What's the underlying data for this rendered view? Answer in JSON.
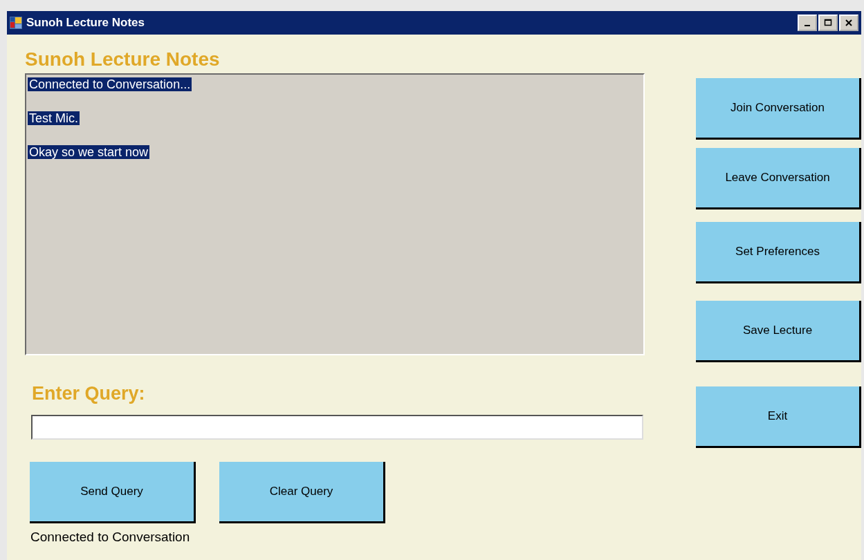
{
  "window": {
    "title": "Sunoh Lecture Notes"
  },
  "heading": "Sunoh Lecture Notes",
  "log": [
    {
      "text": "Connected to Conversation...",
      "selected": true
    },
    {
      "text": "Test Mic.",
      "selected": true
    },
    {
      "text": "Okay so we start now",
      "selected": true
    }
  ],
  "side_buttons": [
    "Join Conversation",
    "Leave Conversation",
    "Set Preferences",
    "Save Lecture",
    "Exit"
  ],
  "query": {
    "label": "Enter Query:"
  },
  "query_buttons": [
    "Send Query",
    "Clear Query"
  ],
  "status": "Connected to Conversation"
}
